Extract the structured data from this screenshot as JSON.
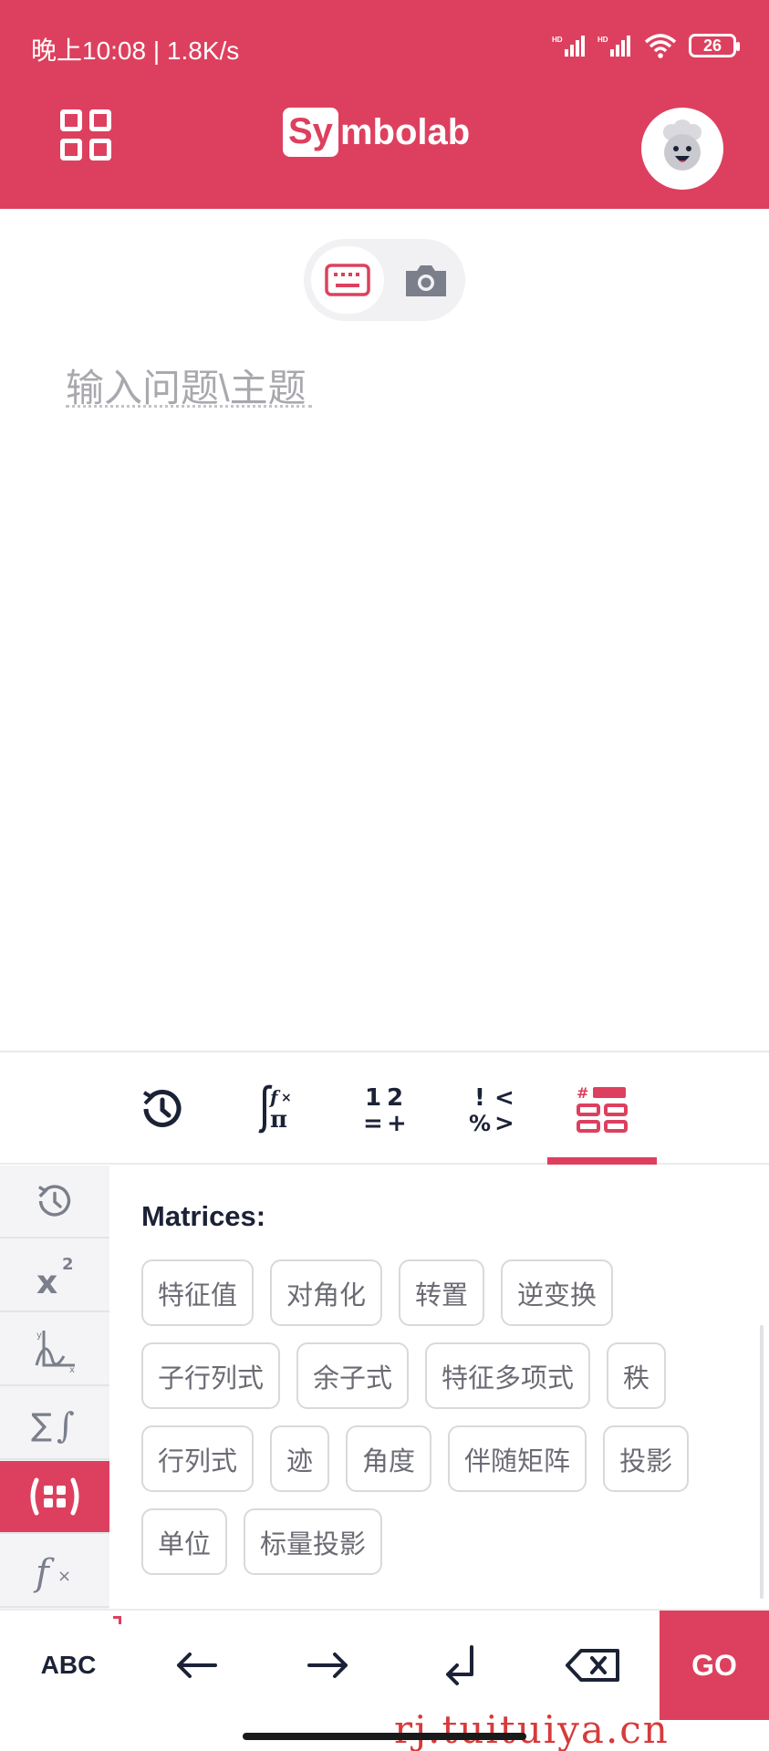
{
  "status": {
    "time_speed": "晚上10:08 | 1.8K/s",
    "battery": "26"
  },
  "header": {
    "logo_boxed": "Sy",
    "logo_rest": "mbolab"
  },
  "input": {
    "placeholder": "输入问题\\主题"
  },
  "keyboard": {
    "top_tabs": [
      {
        "icon": "history-icon"
      },
      {
        "icon": "integral-function-icon"
      },
      {
        "icon": "numbers-icon"
      },
      {
        "icon": "symbols-icon"
      },
      {
        "icon": "matrix-template-icon",
        "active": true
      }
    ],
    "side_tabs": [
      {
        "icon": "history-icon"
      },
      {
        "icon": "power-icon"
      },
      {
        "icon": "graph-axes-icon"
      },
      {
        "icon": "sum-integral-icon"
      },
      {
        "icon": "matrix-icon",
        "active": true
      },
      {
        "icon": "function-icon"
      }
    ],
    "panel_title": "Matrices:",
    "chips": [
      "特征值",
      "对角化",
      "转置",
      "逆变换",
      "子行列式",
      "余子式",
      "特征多项式",
      "秩",
      "行列式",
      "迹",
      "角度",
      "伴随矩阵",
      "投影",
      "单位",
      "标量投影"
    ],
    "bottom": {
      "abc_label": "ABC",
      "go_label": "GO"
    }
  },
  "watermark": "rj.tuituiya.cn",
  "colors": {
    "brand": "#dd405e",
    "text_dark": "#1c2236",
    "chip_text": "#6b6b74"
  }
}
